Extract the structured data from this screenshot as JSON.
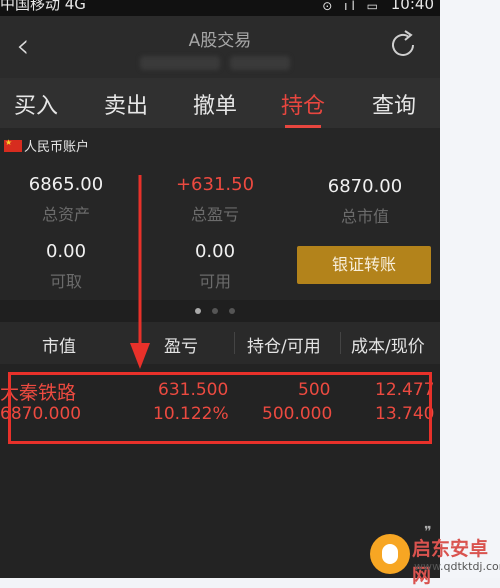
{
  "status_bar": {
    "carrier": "中国移动 4G",
    "time": "10:40"
  },
  "header": {
    "title": "A股交易"
  },
  "tabs": [
    {
      "label": "买入",
      "active": false
    },
    {
      "label": "卖出",
      "active": false
    },
    {
      "label": "撤单",
      "active": false
    },
    {
      "label": "持仓",
      "active": true
    },
    {
      "label": "查询",
      "active": false
    }
  ],
  "account": {
    "label": "人民币账户",
    "total_assets": {
      "value": "6865.00",
      "label": "总资产"
    },
    "total_pnl": {
      "value": "+631.50",
      "label": "总盈亏"
    },
    "market_value": {
      "value": "6870.00",
      "label": "总市值"
    },
    "withdrawable": {
      "value": "0.00",
      "label": "可取"
    },
    "available": {
      "value": "0.00",
      "label": "可用"
    },
    "transfer_button": "银证转账"
  },
  "table": {
    "headers": [
      "市值",
      "盈亏",
      "持仓/可用",
      "成本/现价"
    ],
    "rows": [
      {
        "name": "大秦铁路",
        "market_value": "6870.000",
        "pnl": "631.500",
        "pnl_pct": "10.122%",
        "position": "500",
        "available": "500.000",
        "cost": "12.477",
        "price": "13.740"
      }
    ]
  },
  "watermark": {
    "name": "启东安卓网",
    "url": "www.qdtktdj.com"
  },
  "colors": {
    "accent_red": "#e8463f",
    "gold_button": "#b3831b",
    "background": "#2a2a2a"
  }
}
